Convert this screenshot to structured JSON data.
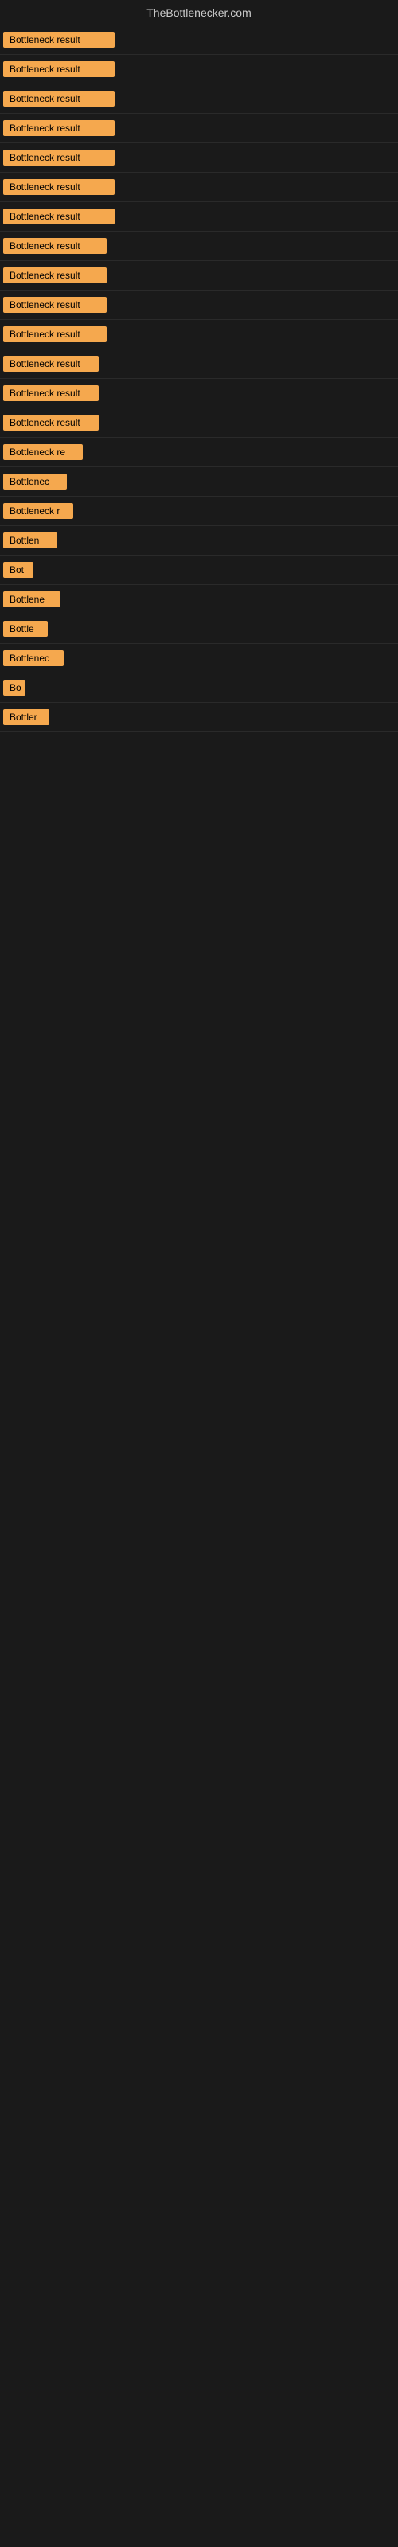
{
  "site": {
    "title": "TheBottlenecker.com"
  },
  "results": [
    {
      "id": 1,
      "label": "Bottleneck result",
      "width": 140
    },
    {
      "id": 2,
      "label": "Bottleneck result",
      "width": 140
    },
    {
      "id": 3,
      "label": "Bottleneck result",
      "width": 140
    },
    {
      "id": 4,
      "label": "Bottleneck result",
      "width": 140
    },
    {
      "id": 5,
      "label": "Bottleneck result",
      "width": 140
    },
    {
      "id": 6,
      "label": "Bottleneck result",
      "width": 140
    },
    {
      "id": 7,
      "label": "Bottleneck result",
      "width": 140
    },
    {
      "id": 8,
      "label": "Bottleneck result",
      "width": 130
    },
    {
      "id": 9,
      "label": "Bottleneck result",
      "width": 130
    },
    {
      "id": 10,
      "label": "Bottleneck result",
      "width": 130
    },
    {
      "id": 11,
      "label": "Bottleneck result",
      "width": 130
    },
    {
      "id": 12,
      "label": "Bottleneck result",
      "width": 120
    },
    {
      "id": 13,
      "label": "Bottleneck result",
      "width": 120
    },
    {
      "id": 14,
      "label": "Bottleneck result",
      "width": 120
    },
    {
      "id": 15,
      "label": "Bottleneck re",
      "width": 100
    },
    {
      "id": 16,
      "label": "Bottlenec",
      "width": 80
    },
    {
      "id": 17,
      "label": "Bottleneck r",
      "width": 88
    },
    {
      "id": 18,
      "label": "Bottlen",
      "width": 68
    },
    {
      "id": 19,
      "label": "Bot",
      "width": 38
    },
    {
      "id": 20,
      "label": "Bottlene",
      "width": 72
    },
    {
      "id": 21,
      "label": "Bottle",
      "width": 56
    },
    {
      "id": 22,
      "label": "Bottlenec",
      "width": 76
    },
    {
      "id": 23,
      "label": "Bo",
      "width": 28
    },
    {
      "id": 24,
      "label": "Bottler",
      "width": 58
    }
  ]
}
